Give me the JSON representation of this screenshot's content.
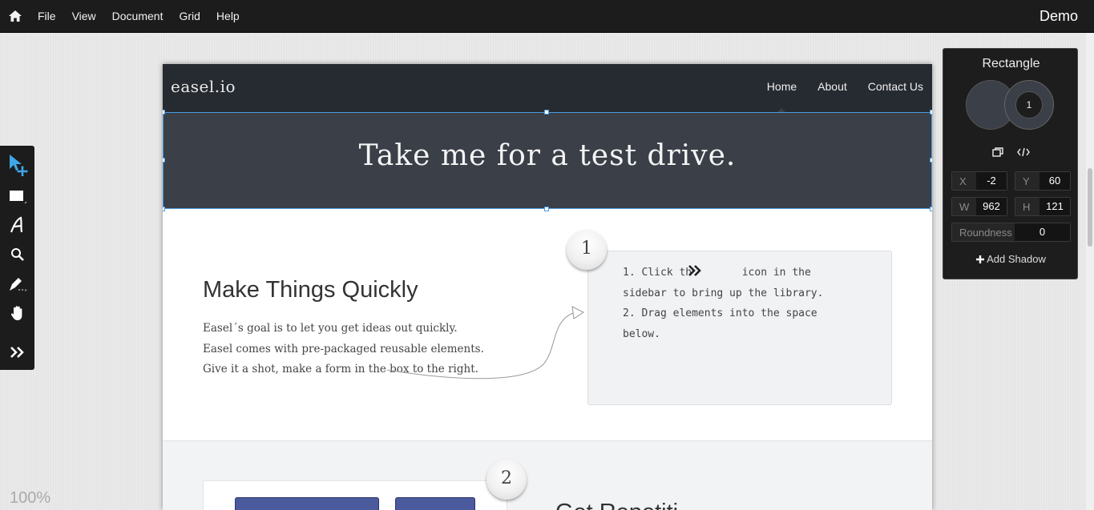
{
  "menubar": {
    "items": [
      "File",
      "View",
      "Document",
      "Grid",
      "Help"
    ],
    "app_title": "Demo"
  },
  "toolbar": {
    "tools": [
      "select-tool-icon",
      "rectangle-tool-icon",
      "text-tool-icon",
      "zoom-tool-icon",
      "pen-tool-icon",
      "hand-tool-icon",
      "expand-library-icon"
    ]
  },
  "zoom_level": "100%",
  "site": {
    "logo": "easel.io",
    "nav": [
      "Home",
      "About",
      "Contact Us"
    ],
    "hero_text": "Take me for a test drive.",
    "section1_title": "Make Things Quickly",
    "section1_body": "Easel´s goal is to let you get ideas out quickly.\nEasel comes with pre-packaged reusable elements.\nGive it a shot, make a form in the box to the right.",
    "step1_number": "1",
    "step1_text_part1": "1. Click th",
    "step1_text_part2": "icon in the\nsidebar to bring up the library.\n2. Drag elements into the space\nbelow.",
    "step2_number": "2",
    "section2_heading": "Get Repetiti"
  },
  "panel": {
    "title": "Rectangle",
    "border_width": "1",
    "x_label": "X",
    "x_value": "-2",
    "y_label": "Y",
    "y_value": "60",
    "w_label": "W",
    "w_value": "962",
    "h_label": "H",
    "h_value": "121",
    "roundness_label": "Roundness",
    "roundness_value": "0",
    "add_shadow": "Add Shadow"
  },
  "colors": {
    "fill": "#3a3f48",
    "accent_selection": "#4a9be0",
    "chrome": "#1c1c1c"
  }
}
